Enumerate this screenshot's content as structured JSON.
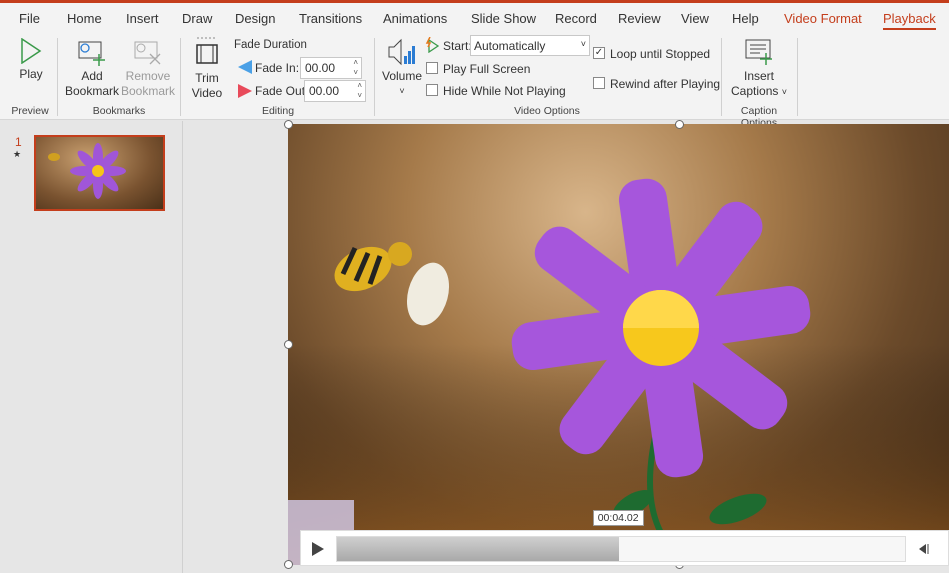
{
  "menu": {
    "tabs": [
      "File",
      "Home",
      "Insert",
      "Draw",
      "Design",
      "Transitions",
      "Animations",
      "Slide Show",
      "Record",
      "Review",
      "View",
      "Help",
      "Video Format",
      "Playback"
    ],
    "active": "Playback"
  },
  "ribbon": {
    "preview": {
      "play": "Play",
      "group": "Preview"
    },
    "bookmarks": {
      "add": [
        "Add",
        "Bookmark"
      ],
      "remove": [
        "Remove",
        "Bookmark"
      ],
      "group": "Bookmarks"
    },
    "editing": {
      "trim": [
        "Trim",
        "Video"
      ],
      "fade_duration": "Fade Duration",
      "fade_in_label": "Fade In:",
      "fade_in": "00.00",
      "fade_out_label": "Fade Out:",
      "fade_out": "00.00",
      "group": "Editing"
    },
    "video_options": {
      "volume": "Volume",
      "start_label": "Start:",
      "start_value": "Automatically",
      "play_full_screen": "Play Full Screen",
      "play_full_screen_checked": false,
      "hide_while": "Hide While Not Playing",
      "hide_while_checked": false,
      "loop": "Loop until Stopped",
      "loop_checked": true,
      "rewind": "Rewind after Playing",
      "rewind_checked": false,
      "group": "Video Options"
    },
    "captions": {
      "insert": [
        "Insert",
        "Captions"
      ],
      "group": "Caption Options"
    }
  },
  "thumbs": [
    {
      "number": "1",
      "star": "★"
    }
  ],
  "player": {
    "time": "00:04.02",
    "progress": 0.496
  },
  "colors": {
    "accent": "#c43e1c"
  }
}
